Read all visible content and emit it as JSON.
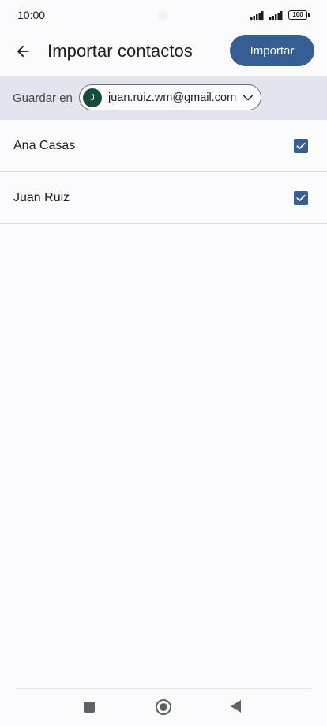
{
  "status_bar": {
    "time": "10:00",
    "battery_level": "100"
  },
  "header": {
    "title": "Importar contactos",
    "import_button_label": "Importar"
  },
  "save_in": {
    "label": "Guardar en",
    "account_initial": "J",
    "account_email": "juan.ruiz.wm@gmail.com"
  },
  "contacts": [
    {
      "name": "Ana Casas",
      "checked": true
    },
    {
      "name": "Juan Ruiz",
      "checked": true
    }
  ],
  "icons": {
    "back": "arrow-left-icon",
    "chevron": "chevron-down-icon",
    "check": "check-icon",
    "nav_recents": "square-icon",
    "nav_home": "circle-icon",
    "nav_back": "triangle-left-icon"
  },
  "colors": {
    "accent": "#355f94",
    "avatar_bg": "#124d3f",
    "strip_bg": "#e3e5ee",
    "page_bg": "#fbfbfe"
  }
}
